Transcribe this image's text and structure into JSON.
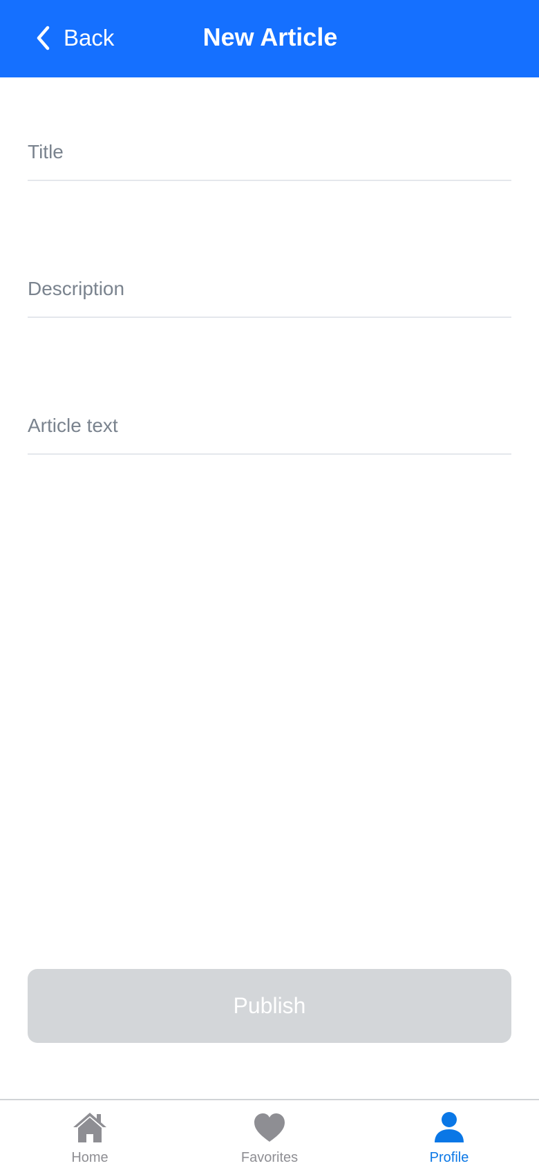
{
  "header": {
    "back_label": "Back",
    "back_icon": "chevron-left-icon",
    "title": "New Article",
    "background_color": "#1570ff"
  },
  "form": {
    "title_placeholder": "Title",
    "title_value": "",
    "description_placeholder": "Description",
    "description_value": "",
    "body_placeholder": "Article text",
    "body_value": ""
  },
  "publish_button": {
    "label": "Publish",
    "disabled": true
  },
  "tabbar": {
    "items": [
      {
        "label": "Home",
        "icon": "home-icon",
        "active": false
      },
      {
        "label": "Favorites",
        "icon": "heart-icon",
        "active": false
      },
      {
        "label": "Profile",
        "icon": "person-icon",
        "active": true
      }
    ],
    "active_color": "#0a77e6",
    "inactive_color": "#8e8e93"
  }
}
